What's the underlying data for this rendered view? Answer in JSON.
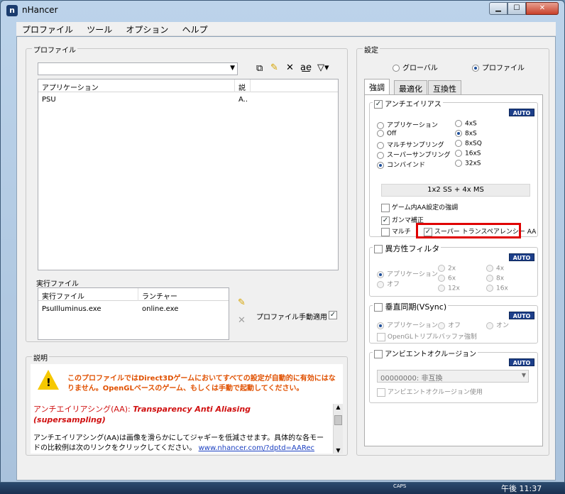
{
  "window": {
    "title": "nHancer",
    "min_label": "▁",
    "max_label": "☐",
    "close_label": "✕"
  },
  "menu": [
    "プロファイル",
    "ツール",
    "オプション",
    "ヘルプ"
  ],
  "profiles": {
    "group_title": "プロファイル",
    "columns": [
      "アプリケーション",
      "説"
    ],
    "rows": [
      [
        "PSU",
        "A.."
      ]
    ]
  },
  "exec_files": {
    "group_title": "実行ファイル",
    "columns": [
      "実行ファイル",
      "ランチャー"
    ],
    "rows": [
      [
        "PsuIlluminus.exe",
        "online.exe"
      ]
    ],
    "manual_apply_label": "プロファイル手動適用"
  },
  "description": {
    "group_title": "説明",
    "warning": "このプロファイルではDirect3Dゲームにおいてすべての設定が自動的に有効にはなりません。OpenGLベースのゲーム、もしくは手動で起動してください。",
    "heading": "アンチエイリアシング(AA): ",
    "heading_italic": "Transparency Anti Aliasing (supersampling)",
    "body": "アンチエイリアシング(AA)は画像を滑らかにしてジャギーを低減させます。具体的な各モードの比較例は次のリンクをクリックしてください。",
    "link": "www.nhancer.com/?dptd=AARec"
  },
  "settings": {
    "group_title": "設定",
    "scope_global": "グローバル",
    "scope_profile": "プロファイル",
    "tabs": [
      "強調",
      "最適化",
      "互換性"
    ],
    "auto_label": "AUTO",
    "aa": {
      "title": "アンチエイリアス",
      "modes": [
        "アプリケーション",
        "Off",
        "マルチサンプリング",
        "スーパーサンプリング",
        "コンバインド"
      ],
      "levels": [
        "4xS",
        "8xS",
        "8xSQ",
        "16xS",
        "32xS"
      ],
      "selected_mode": "コンバインド",
      "selected_level": "8xS",
      "summary": "1x2 SS + 4x MS",
      "opt_enhance": "ゲーム内AA設定の強調",
      "opt_gamma": "ガンマ補正",
      "opt_multi": "マルチ",
      "opt_super_trans": "スーパー  トランスペアレンシー AA"
    },
    "af": {
      "title": "異方性フィルタ",
      "modes": [
        "アプリケーション",
        "オフ"
      ],
      "levels_a": [
        "2x",
        "6x",
        "12x"
      ],
      "levels_b": [
        "4x",
        "8x",
        "16x"
      ]
    },
    "vsync": {
      "title": "垂直同期(VSync)",
      "modes": [
        "アプリケーション",
        "オフ",
        "オン"
      ],
      "opengl_triple": "OpenGLトリプルバッファ強制"
    },
    "ao": {
      "title": "アンビエントオクルージョン",
      "select_value": "00000000: 非互換",
      "use_label": "アンビエントオクルージョン使用"
    }
  },
  "taskbar": {
    "caps": "CAPS",
    "time": "午後 11:37"
  }
}
